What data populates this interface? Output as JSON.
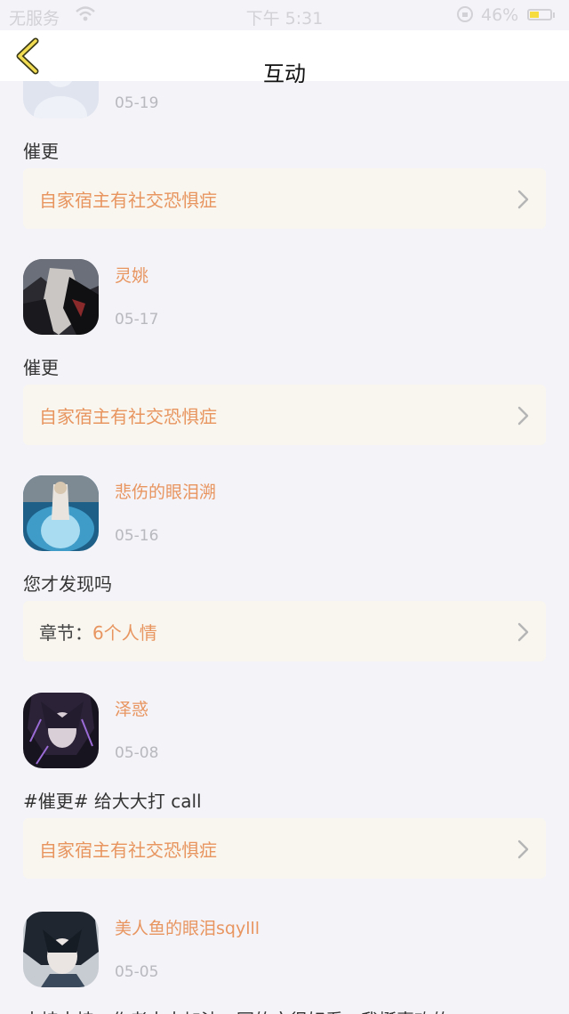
{
  "status_bar": {
    "carrier": "无服务",
    "time": "下午 5:31",
    "battery": "46%"
  },
  "nav": {
    "title": "互动"
  },
  "items": [
    {
      "name": "",
      "date": "05-19",
      "content": "催更",
      "link_prefix": "",
      "link": "自家宿主有社交恐惧症"
    },
    {
      "name": "灵姚",
      "date": "05-17",
      "content": "催更",
      "link_prefix": "",
      "link": "自家宿主有社交恐惧症"
    },
    {
      "name": "悲伤的眼泪溯",
      "date": "05-16",
      "content": "您才发现吗",
      "link_prefix": "章节：",
      "link": "6个人情"
    },
    {
      "name": "泽惑",
      "date": "05-08",
      "content": "#催更# 给大大打 call",
      "link_prefix": "",
      "link": "自家宿主有社交恐惧症"
    },
    {
      "name": "美人鱼的眼泪sqylll",
      "date": "05-05",
      "content": "支持支持，作者大大加油，写的文很好看，我挺喜欢的",
      "link_prefix": "",
      "link": ""
    }
  ],
  "colors": {
    "accent": "#e89560",
    "card_bg": "#f8f6ee",
    "page_bg": "#f4f3f8"
  }
}
